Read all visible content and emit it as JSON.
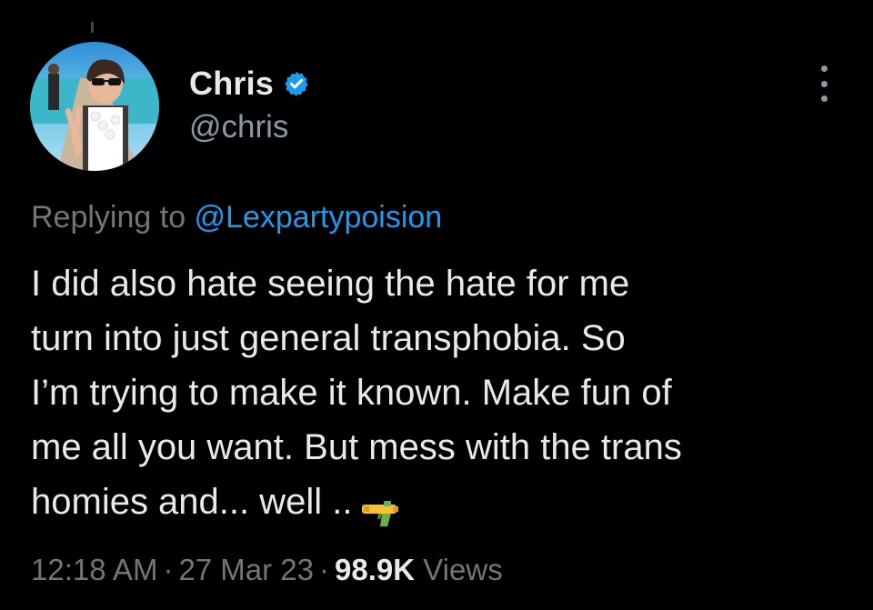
{
  "author": {
    "display_name": "Chris",
    "handle": "@chris",
    "verified": true,
    "verified_color": "#1d9bf0",
    "avatar_icon": "profile-photo"
  },
  "reply": {
    "prefix": "Replying to ",
    "mention": "@Lexpartypoision"
  },
  "body": {
    "lines": [
      "I did also hate seeing the hate for me",
      "turn into just general transphobia. So",
      "I’m trying to make it known. Make fun of",
      "me all you want. But mess with the trans",
      "homies and... well .."
    ],
    "emoji": "water-pistol-emoji"
  },
  "meta": {
    "time": "12:18 AM",
    "sep1": "·",
    "date": "27 Mar 23",
    "sep2": "·",
    "views_count": "98.9K",
    "views_label": " Views"
  },
  "menu_icon": "more-options-icon"
}
